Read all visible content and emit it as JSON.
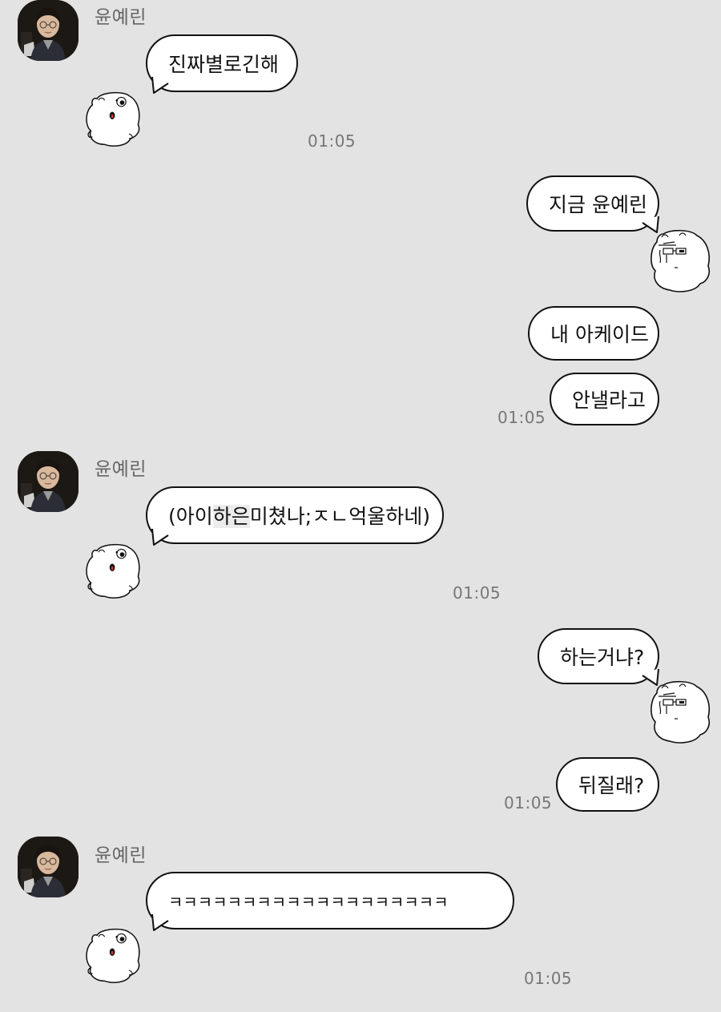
{
  "contact": {
    "name": "윤예린",
    "avatar_icon": "profile-photo"
  },
  "messages": {
    "m1": {
      "text": "진짜별로긴해",
      "time": "01:05"
    },
    "m2": {
      "text": "지금 윤예린"
    },
    "m3": {
      "text": "내 아케이드"
    },
    "m4": {
      "text": "안낼라고",
      "time": "01:05"
    },
    "m5": {
      "text_a": "(아이",
      "text_b": "하은",
      "text_c": "미쳤나;ㅈㄴ억울하네)",
      "time": "01:05"
    },
    "m6": {
      "text": "하는거냐?"
    },
    "m7": {
      "text": "뒤질래?",
      "time": "01:05"
    },
    "m8": {
      "text": "ㅋㅋㅋㅋㅋㅋㅋㅋㅋㅋㅋㅋㅋㅋㅋㅋㅋㅋㅋ",
      "time": "01:05"
    }
  },
  "colors": {
    "background": "#e3e3e3",
    "bubble": "#ffffff",
    "outline": "#111111",
    "meta_text": "#777777"
  }
}
